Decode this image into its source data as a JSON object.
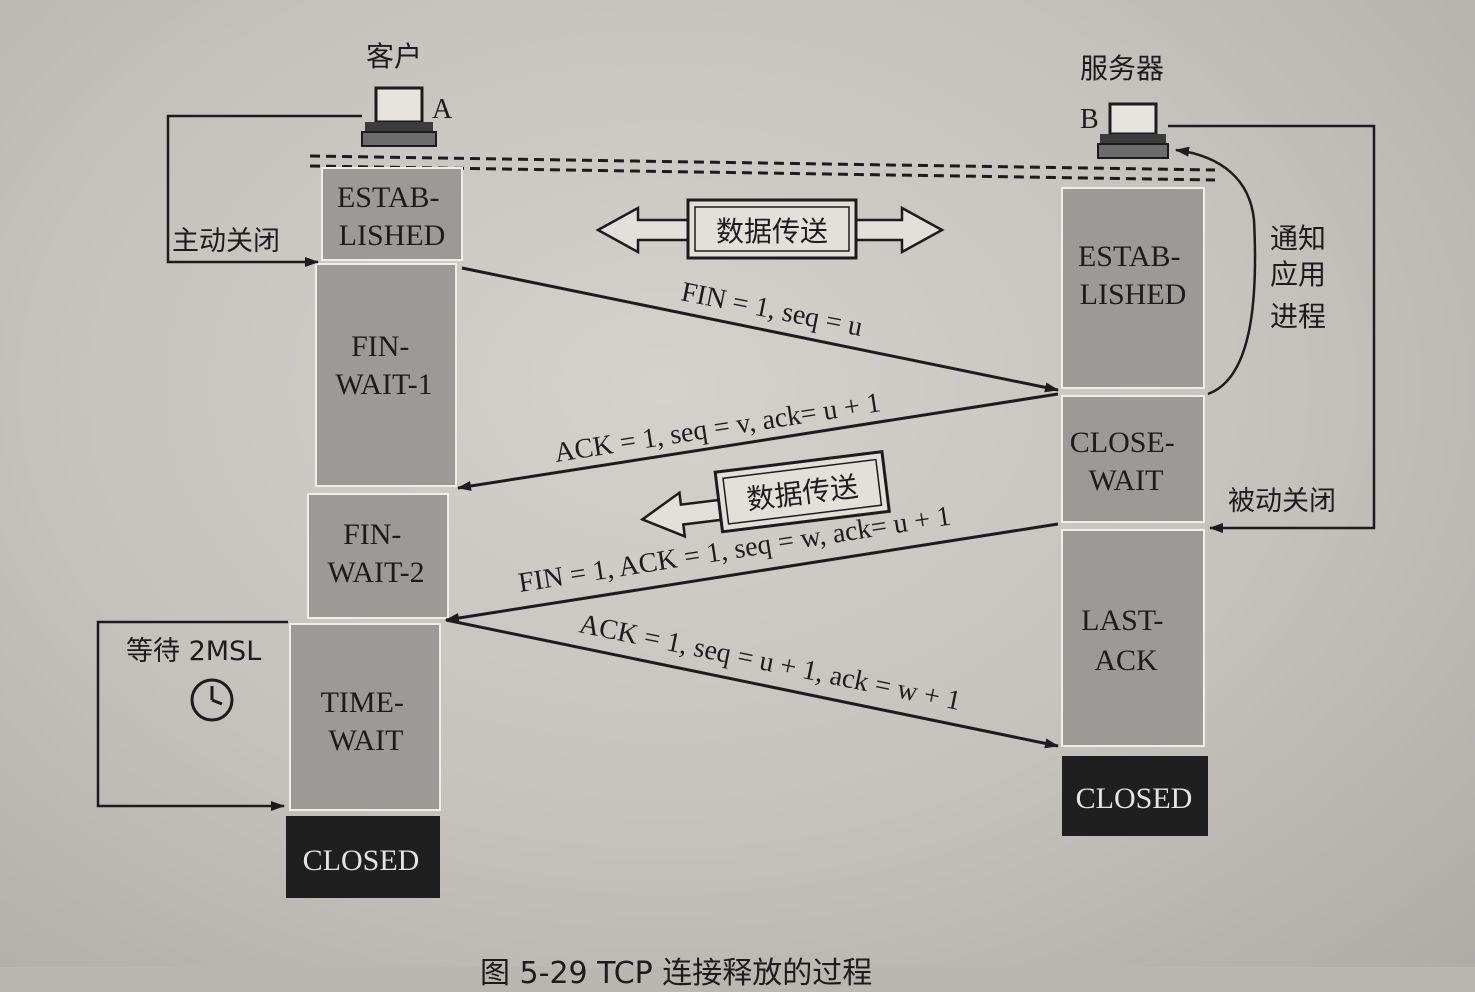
{
  "client": {
    "title": "客户",
    "letter": "A",
    "states": [
      "ESTAB-\nLISHED",
      "FIN-\nWAIT-1",
      "FIN-\nWAIT-2",
      "TIME-\nWAIT"
    ],
    "closed": "CLOSED"
  },
  "server": {
    "title": "服务器",
    "letter": "B",
    "states": [
      "ESTAB-\nLISHED",
      "CLOSE-\nWAIT",
      "LAST-\nACK"
    ],
    "closed": "CLOSED"
  },
  "labels": {
    "active_close": "主动关闭",
    "passive_close": "被动关闭",
    "notify_app": "通知\n应用\n进程",
    "data_transfer_1": "数据传送",
    "data_transfer_2": "数据传送",
    "wait_2msl": "等待 2MSL"
  },
  "messages": [
    "FIN = 1, seq = u",
    "ACK = 1, seq = v, ack= u + 1",
    "FIN = 1, ACK = 1, seq = w, ack= u + 1",
    "ACK = 1, seq = u + 1, ack = w + 1"
  ],
  "caption": "图 5-29   TCP 连接释放的过程"
}
